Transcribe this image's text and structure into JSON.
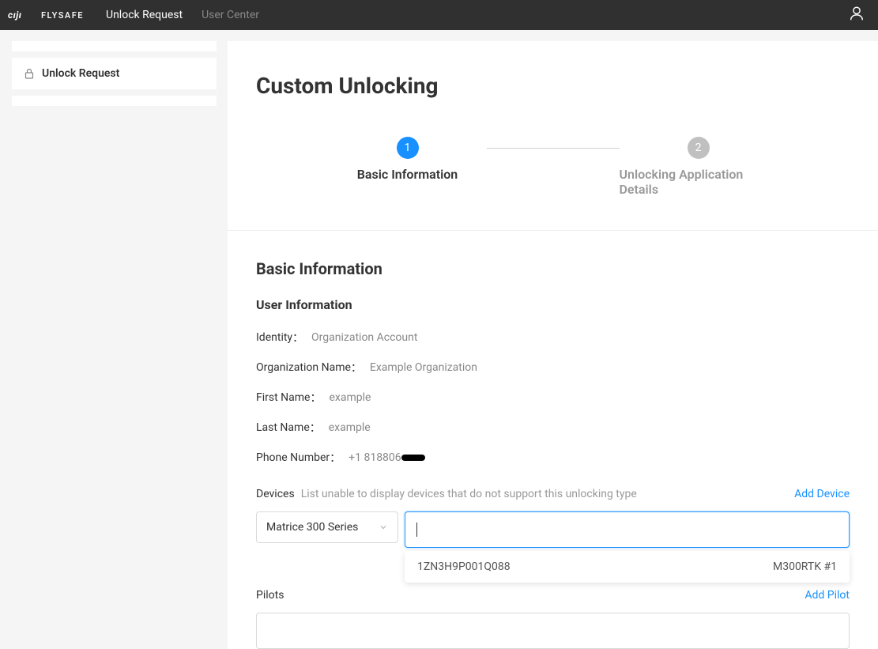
{
  "header": {
    "logo": {
      "brand": "DJI",
      "sub": "FLYSAFE"
    },
    "nav": [
      {
        "label": "Unlock Request",
        "active": true
      },
      {
        "label": "User Center",
        "active": false
      }
    ]
  },
  "sidebar": {
    "item": {
      "label": "Unlock Request"
    }
  },
  "page": {
    "title": "Custom Unlocking"
  },
  "stepper": {
    "steps": [
      {
        "num": "1",
        "label": "Basic Information",
        "active": true
      },
      {
        "num": "2",
        "label": "Unlocking Application Details",
        "active": false
      }
    ]
  },
  "section": {
    "title": "Basic Information",
    "userInfo": {
      "title": "User Information",
      "rows": [
        {
          "label": "Identity",
          "value": "Organization Account"
        },
        {
          "label": "Organization Name",
          "value": "Example Organization"
        },
        {
          "label": "First Name",
          "value": "example"
        },
        {
          "label": "Last Name",
          "value": "example"
        },
        {
          "label": "Phone Number",
          "value": "+1 818806"
        }
      ]
    },
    "devices": {
      "label": "Devices",
      "hint": "List unable to display devices that do not support this unlocking type",
      "addLink": "Add Device",
      "selected": "Matrice 300 Series",
      "dropdown": {
        "serial": "1ZN3H9P001Q088",
        "model": "M300RTK #1"
      }
    },
    "pilots": {
      "label": "Pilots",
      "addLink": "Add Pilot"
    }
  }
}
